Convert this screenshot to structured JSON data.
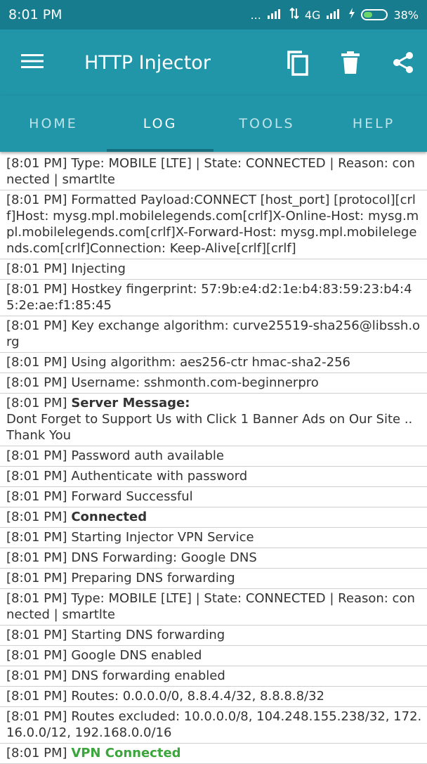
{
  "status": {
    "time": "8:01 PM",
    "dots": "...",
    "network": "4G",
    "battery": "38%",
    "battery_level": 0.38
  },
  "toolbar": {
    "title": "HTTP Injector"
  },
  "tabs": [
    "HOME",
    "LOG",
    "TOOLS",
    "HELP"
  ],
  "active_tab": "LOG",
  "log": [
    {
      "ts": "[8:01 PM]",
      "msg": "Type: MOBILE [LTE] | State: CONNECTED | Reason: connected | smartlte"
    },
    {
      "ts": "[8:01 PM]",
      "msg": "Formatted Payload:CONNECT [host_port] [protocol][crlf]Host: mysg.mpl.mobilelegends.com[crlf]X-Online-Host: mysg.mpl.mobilelegends.com[crlf]X-Forward-Host: mysg.mpl.mobilelegends.com[crlf]Connection: Keep-Alive[crlf][crlf]"
    },
    {
      "ts": "[8:01 PM]",
      "msg": "Injecting"
    },
    {
      "ts": "[8:01 PM]",
      "msg": "Hostkey fingerprint: 57:9b:e4:d2:1e:b4:83:59:23:b4:45:2e:ae:f1:85:45"
    },
    {
      "ts": "[8:01 PM]",
      "msg": "Key exchange algorithm: curve25519-sha256@libssh.org"
    },
    {
      "ts": "[8:01 PM]",
      "msg": "Using algorithm: aes256-ctr hmac-sha2-256"
    },
    {
      "ts": "[8:01 PM]",
      "msg": "Username: sshmonth.com-beginnerpro"
    },
    {
      "ts": "[8:01 PM]",
      "bold": "Server Message:",
      "msg": "Dont Forget to Support Us with Click 1 Banner Ads on Our Site .. Thank You"
    },
    {
      "ts": "[8:01 PM]",
      "msg": "Password auth available"
    },
    {
      "ts": "[8:01 PM]",
      "msg": "Authenticate with password"
    },
    {
      "ts": "[8:01 PM]",
      "msg": "Forward Successful"
    },
    {
      "ts": "[8:01 PM]",
      "bold": "Connected"
    },
    {
      "ts": "[8:01 PM]",
      "msg": "Starting Injector VPN Service"
    },
    {
      "ts": "[8:01 PM]",
      "msg": "DNS Forwarding: Google DNS"
    },
    {
      "ts": "[8:01 PM]",
      "msg": "Preparing DNS forwarding"
    },
    {
      "ts": "[8:01 PM]",
      "msg": "Type: MOBILE [LTE] | State: CONNECTED | Reason: connected | smartlte"
    },
    {
      "ts": "[8:01 PM]",
      "msg": "Starting DNS forwarding"
    },
    {
      "ts": "[8:01 PM]",
      "msg": "Google DNS enabled"
    },
    {
      "ts": "[8:01 PM]",
      "msg": "DNS forwarding enabled"
    },
    {
      "ts": "[8:01 PM]",
      "msg": "Routes: 0.0.0.0/0, 8.8.4.4/32, 8.8.8.8/32"
    },
    {
      "ts": "[8:01 PM]",
      "msg": "Routes excluded: 10.0.0.0/8, 104.248.155.238/32, 172.16.0.0/12, 192.168.0.0/16"
    },
    {
      "ts": "[8:01 PM]",
      "green": "VPN Connected"
    }
  ],
  "colors": {
    "status_bar": "#167c8e",
    "toolbar": "#2196a9",
    "success": "#3ca53c"
  }
}
